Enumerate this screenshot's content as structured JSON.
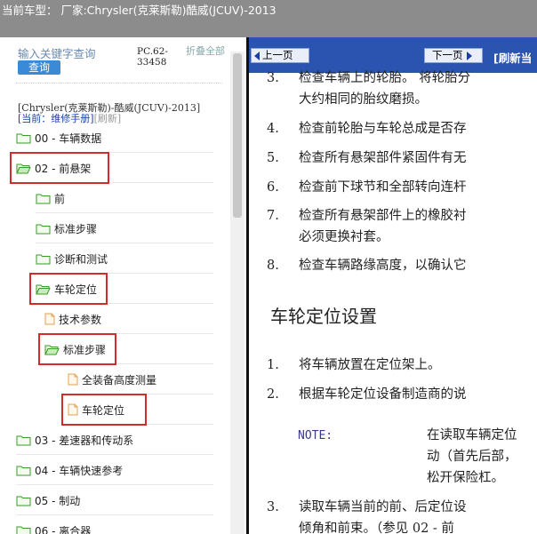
{
  "title_bar": "当前车型： 厂家:Chrysler(克莱斯勒)酷威(JCUV)-2013",
  "left": {
    "search_placeholder": "输入关键字查询",
    "search_button": "查询",
    "pc_code": "PC.62-33458",
    "collapse_all": "折叠全部",
    "vehicle_path": "[Chrysler(克莱斯勒)-酷威(JCUV)-2013]",
    "current_label": "[当前：维修手册]",
    "refresh_label": "[刷新]",
    "tree": [
      {
        "label": "00 - 车辆数据",
        "icon": "folder-icon"
      },
      {
        "label": "02 - 前悬架",
        "icon": "folder-open-icon"
      },
      {
        "label": "前",
        "icon": "folder-icon"
      },
      {
        "label": "标准步骤",
        "icon": "folder-icon"
      },
      {
        "label": "诊断和测试",
        "icon": "folder-icon"
      },
      {
        "label": "车轮定位",
        "icon": "folder-open-icon"
      },
      {
        "label": "技术参数",
        "icon": "document-icon"
      },
      {
        "label": "标准步骤",
        "icon": "folder-open-icon"
      },
      {
        "label": "全装备高度测量",
        "icon": "document-icon"
      },
      {
        "label": "车轮定位",
        "icon": "document-icon"
      },
      {
        "label": "03 - 差速器和传动系",
        "icon": "folder-icon"
      },
      {
        "label": "04 - 车辆快速参考",
        "icon": "folder-icon"
      },
      {
        "label": "05 - 制动",
        "icon": "folder-icon"
      },
      {
        "label": "06 - 离合器",
        "icon": "folder-icon"
      }
    ]
  },
  "right": {
    "prev_page": "上一页",
    "next_page": "下一页",
    "refresh_link": "[刷新当",
    "items": [
      {
        "num": "3.",
        "text": "检查车辆上的轮胎。 将轮胎分"
      },
      {
        "num": "",
        "text": "大约相同的胎纹磨损。"
      },
      {
        "num": "4.",
        "text": "检查前轮胎与车轮总成是否存"
      },
      {
        "num": "5.",
        "text": "检查所有悬架部件紧固件有无"
      },
      {
        "num": "6.",
        "text": "检查前下球节和全部转向连杆"
      },
      {
        "num": "7.",
        "text": "检查所有悬架部件上的橡胶衬"
      },
      {
        "num": "",
        "text": "必须更换衬套。"
      },
      {
        "num": "8.",
        "text": "检查车辆路缘高度，以确认它"
      }
    ],
    "section_heading": "车轮定位设置",
    "steps": [
      {
        "num": "1.",
        "text": "将车辆放置在定位架上。"
      },
      {
        "num": "2.",
        "text": "根据车轮定位设备制造商的说"
      }
    ],
    "note_label": "NOTE:",
    "note_lines": [
      "在读取车辆定位",
      "动（首先后部，",
      "松开保险杠。"
    ],
    "step3": [
      {
        "num": "3.",
        "text": "读取车辆当前的前、后定位设"
      },
      {
        "num": "",
        "text": "倾角和前束。（参见 02 - 前"
      }
    ]
  }
}
